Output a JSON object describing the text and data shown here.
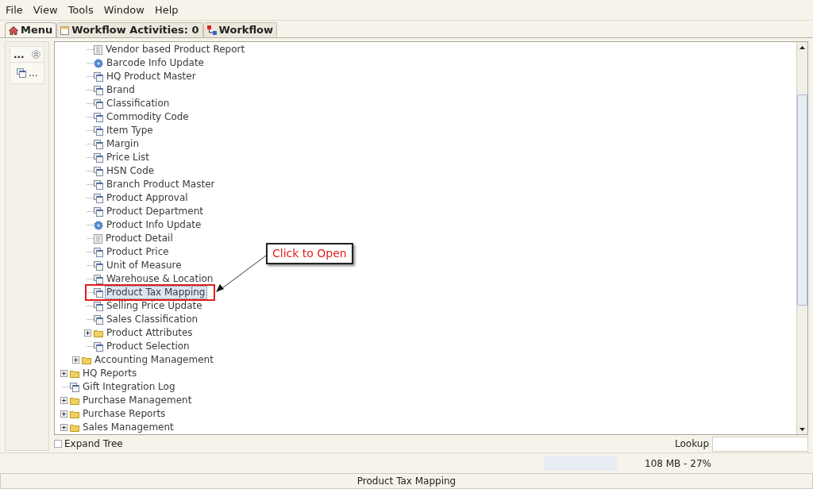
{
  "menu_bar": [
    "File",
    "View",
    "Tools",
    "Window",
    "Help"
  ],
  "tabs": [
    {
      "label": "Menu",
      "selected": true
    },
    {
      "label": "Workflow Activities: 0",
      "selected": false
    },
    {
      "label": "Workflow",
      "selected": false
    }
  ],
  "side_panel": {
    "header": "...",
    "items": [
      "..."
    ]
  },
  "tree": [
    {
      "children": [
        {
          "children": [
            {
              "label": "Vendor based Product Report",
              "kind": "report",
              "selected": false
            },
            {
              "label": "Barcode Info Update",
              "kind": "process",
              "selected": false
            },
            {
              "label": "HQ Product Master",
              "kind": "window",
              "selected": false
            },
            {
              "label": "Brand",
              "kind": "window",
              "selected": false
            },
            {
              "label": "Classification",
              "kind": "window",
              "selected": false
            },
            {
              "label": "Commodity Code",
              "kind": "window",
              "selected": false
            },
            {
              "label": "Item Type",
              "kind": "window",
              "selected": false
            },
            {
              "label": "Margin",
              "kind": "window",
              "selected": false
            },
            {
              "label": "Price List",
              "kind": "window",
              "selected": false
            },
            {
              "label": "HSN Code",
              "kind": "window",
              "selected": false
            },
            {
              "label": "Branch Product Master",
              "kind": "window",
              "selected": false
            },
            {
              "label": "Product Approval",
              "kind": "window",
              "selected": false
            },
            {
              "label": "Product Department",
              "kind": "window",
              "selected": false
            },
            {
              "label": "Product Info Update",
              "kind": "process",
              "selected": false
            },
            {
              "label": "Product Detail",
              "kind": "report",
              "selected": false
            },
            {
              "label": "Product Price",
              "kind": "window",
              "selected": false
            },
            {
              "label": "Unit of Measure",
              "kind": "window",
              "selected": false
            },
            {
              "label": "Warehouse & Location",
              "kind": "window",
              "selected": false
            },
            {
              "label": "Product Tax Mapping",
              "kind": "window",
              "selected": true
            },
            {
              "label": "Selling Price Update",
              "kind": "window",
              "selected": false
            },
            {
              "label": "Sales Classification",
              "kind": "window",
              "selected": false
            },
            {
              "label": "Product Attributes",
              "kind": "folder",
              "selected": false
            },
            {
              "label": "Product Selection",
              "kind": "window",
              "selected": false
            }
          ]
        },
        {
          "label": "Accounting Management",
          "kind": "folder",
          "selected": false
        }
      ]
    },
    {
      "label": "HQ Reports",
      "kind": "folder",
      "selected": false
    },
    {
      "label": "Gift Integration Log",
      "kind": "window",
      "selected": false
    },
    {
      "label": "Purchase Management",
      "kind": "folder",
      "selected": false
    },
    {
      "label": "Purchase Reports",
      "kind": "folder",
      "selected": false
    },
    {
      "label": "Sales Management",
      "kind": "folder",
      "selected": false
    }
  ],
  "callout": "Click to Open",
  "expand_tree": {
    "label": "Expand Tree",
    "checked": false
  },
  "lookup": {
    "label": "Lookup"
  },
  "memory": "108 MB - 27%",
  "status_bar": "Product Tax Mapping"
}
